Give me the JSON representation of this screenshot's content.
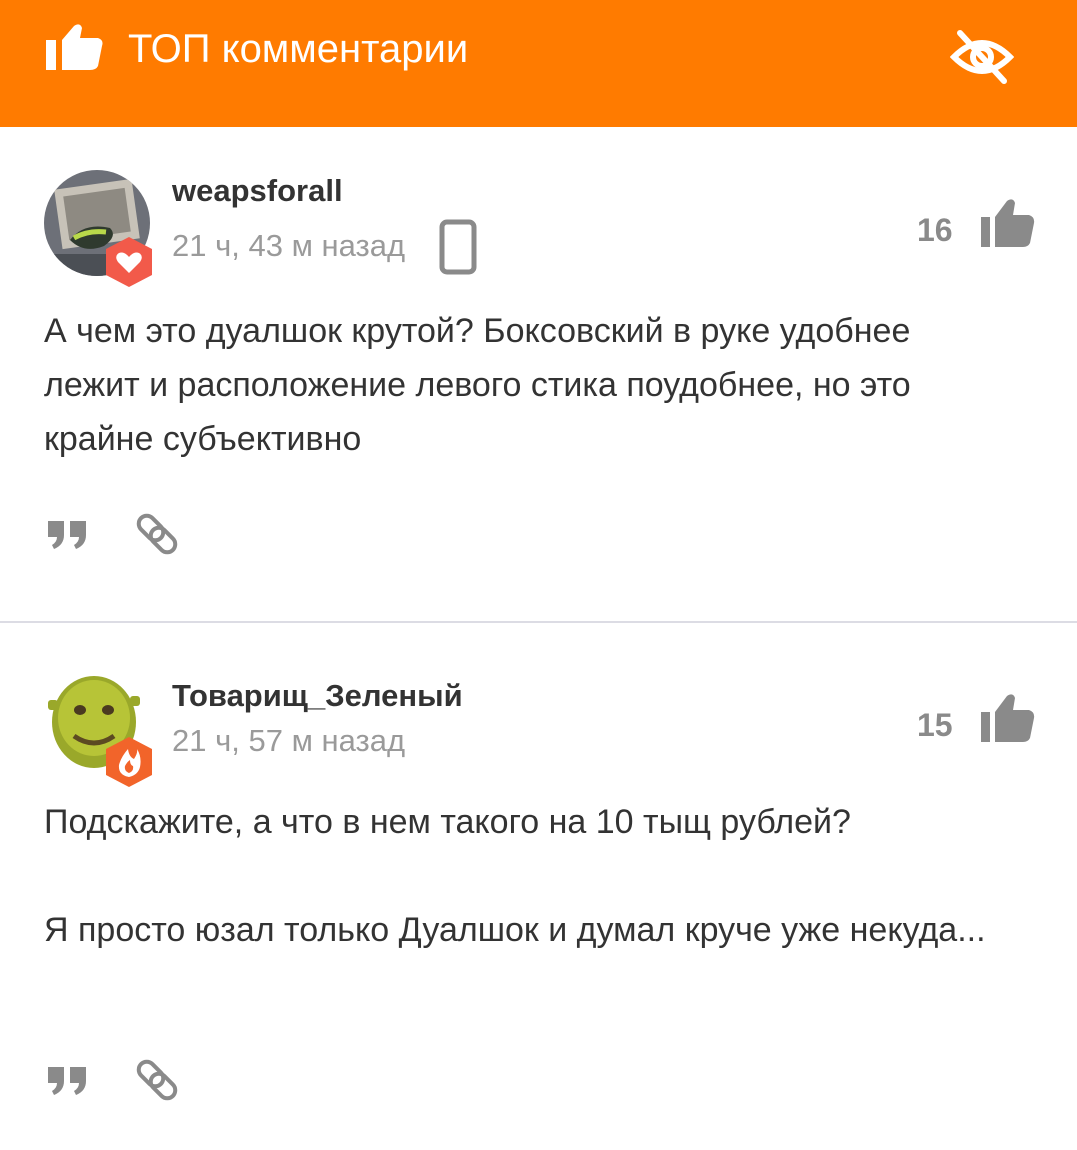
{
  "header": {
    "title": "ТОП комментарии",
    "icon": "thumb-up-icon",
    "hide_icon": "eye-off-icon",
    "background": "#ff7b00"
  },
  "comments": [
    {
      "author": "weapsforall",
      "time": "21 ч, 43 м назад",
      "rating": "16",
      "badge": "heart-badge",
      "device": "mobile-icon",
      "paragraphs": [
        "А чем это дуалшок крутой? Боксовский в руке удобнее лежит и расположение левого стика поудобнее, но это крайне субъективно"
      ]
    },
    {
      "author": "Товарищ_Зеленый",
      "time": "21 ч, 57 м назад",
      "rating": "15",
      "badge": "fire-badge",
      "paragraphs": [
        "Подскажите, а что в нем такого на 10 тыщ рублей?",
        "Я просто юзал только Дуалшок и думал круче уже некуда..."
      ]
    }
  ],
  "colors": {
    "accent": "#ff7b00",
    "badge_red": "#f25a4a",
    "text": "#333333",
    "muted": "#9a9a9a"
  }
}
